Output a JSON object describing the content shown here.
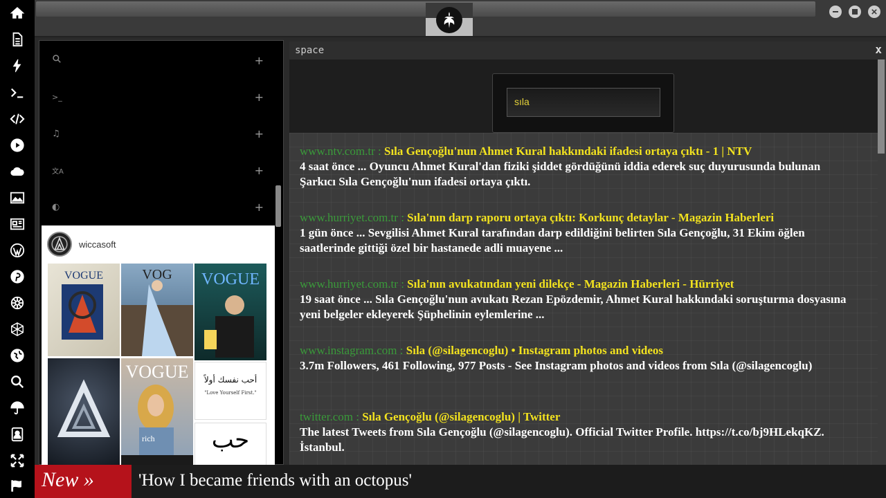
{
  "rail": [
    {
      "icon": "home-icon"
    },
    {
      "icon": "document-icon"
    },
    {
      "icon": "bolt-icon"
    },
    {
      "icon": "terminal-icon"
    },
    {
      "icon": "code-icon"
    },
    {
      "icon": "play-icon"
    },
    {
      "icon": "cloud-icon"
    },
    {
      "icon": "image-icon"
    },
    {
      "icon": "newspaper-icon"
    },
    {
      "icon": "wordpress-icon"
    },
    {
      "icon": "pinterest-icon"
    },
    {
      "icon": "empire-icon"
    },
    {
      "icon": "geometry-icon"
    },
    {
      "icon": "globe-icon"
    },
    {
      "icon": "search-icon"
    },
    {
      "icon": "umbrella-icon"
    },
    {
      "icon": "contact-icon"
    },
    {
      "icon": "expand-icon"
    },
    {
      "icon": "flag-icon"
    }
  ],
  "left_panel": {
    "rows": [
      {
        "icon": "search-icon",
        "glyph": "🔍",
        "plus": "+"
      },
      {
        "icon": "terminal-icon",
        "glyph": ">_",
        "plus": "+"
      },
      {
        "icon": "music-icon",
        "glyph": "♫",
        "plus": "+"
      },
      {
        "icon": "translate-icon",
        "glyph": "文A",
        "plus": "+"
      },
      {
        "icon": "contrast-icon",
        "glyph": "◐",
        "plus": "+"
      }
    ],
    "feed": {
      "username": "wiccasoft",
      "tile_texts": [
        "أحب نفسك أولاً",
        "\"Love Yourself First.\"",
        "حب"
      ]
    }
  },
  "main": {
    "title": "space",
    "close": "x",
    "search_value": "sıla",
    "results": [
      {
        "domain": "www.ntv.com.tr :",
        "title": "Sıla Gençoğlu'nun Ahmet Kural hakkındaki ifadesi ortaya çıktı - 1 | NTV",
        "desc": "4 saat önce ... Oyuncu Ahmet Kural'dan fiziki şiddet gördüğünü iddia ederek suç duyurusunda bulunan Şarkıcı Sıla Gençoğlu'nun ifadesi ortaya çıktı."
      },
      {
        "domain": "www.hurriyet.com.tr :",
        "title": "Sıla'nın darp raporu ortaya çıktı: Korkunç detaylar - Magazin Haberleri",
        "desc": "1 gün önce ... Sevgilisi Ahmet Kural tarafından darp edildiğini belirten Sıla Gençoğlu, 31 Ekim öğlen saatlerinde gittiği özel bir hastanede adli muayene ..."
      },
      {
        "domain": "www.hurriyet.com.tr :",
        "title": "Sıla'nın avukatından yeni dilekçe - Magazin Haberleri - Hürriyet",
        "desc": "19 saat önce ... Sıla Gençoğlu'nun avukatı Rezan Epözdemir, Ahmet Kural hakkındaki soruşturma dosyasına yeni belgeler ekleyerek Şüphelinin eylemlerine ..."
      },
      {
        "domain": "www.instagram.com :",
        "title": "Sıla (@silagencoglu) • Instagram photos and videos",
        "desc": "3.7m Followers, 461 Following, 977 Posts - See Instagram photos and videos from Sıla (@silagencoglu)"
      },
      {
        "domain": "twitter.com :",
        "title": "Sıla Gençoğlu (@silagencoglu) | Twitter",
        "desc": "The latest Tweets from Sıla Gençoğlu (@silagencoglu). Official Twitter Profile. https://t.co/bj9HLekqKZ. İstanbul."
      }
    ]
  },
  "ticker": {
    "label": "New »",
    "text": "'How I became friends with an octopus'"
  }
}
